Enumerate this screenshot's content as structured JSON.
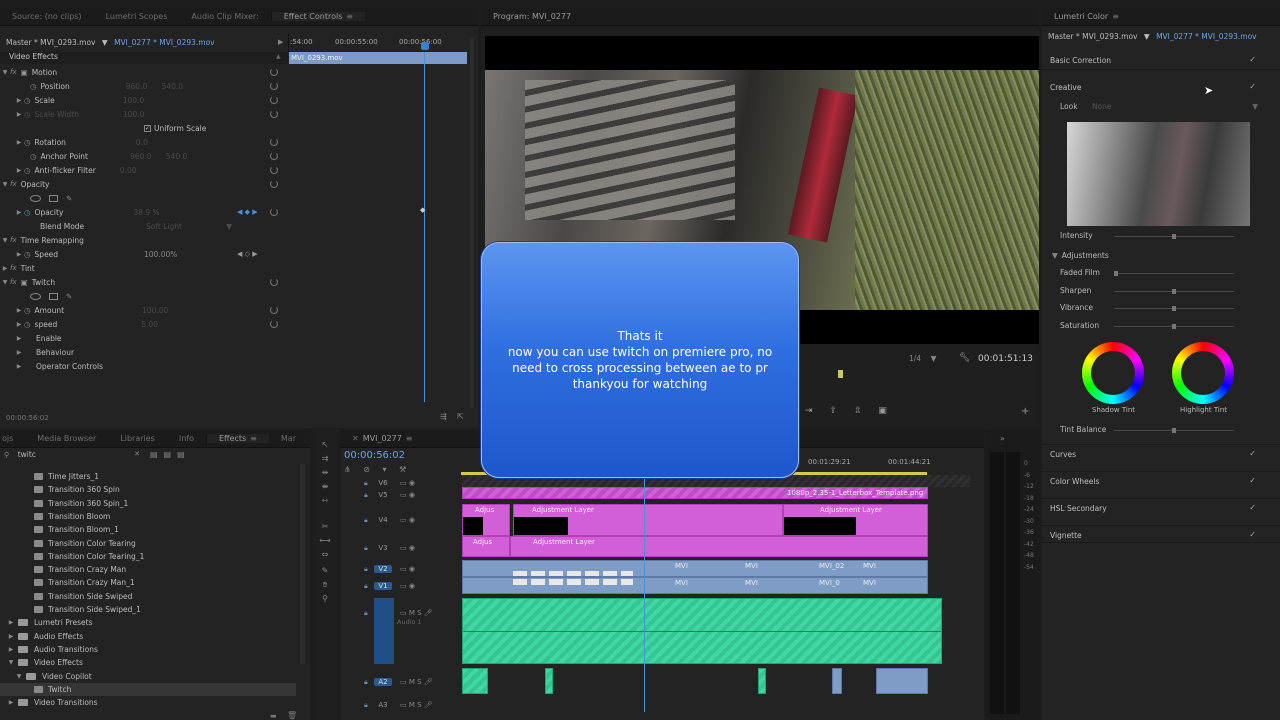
{
  "effect_controls": {
    "tabs": [
      "Source: (no clips)",
      "Lumetri Scopes",
      "Audio Clip Mixer:",
      "Effect Controls"
    ],
    "master_label": "Master * MVI_0293.mov",
    "clip_label": "MVI_0277 * MVI_0293.mov",
    "section_title": "Video Effects",
    "ruler": [
      ":54:00",
      "00:00:55:00",
      "00:00:56:00"
    ],
    "clip_bar": "MVI_0293.mov",
    "rows": {
      "motion": "Motion",
      "position": "Position",
      "scale": "Scale",
      "scale_width": "Scale Width",
      "uniform_scale": "Uniform Scale",
      "rotation": "Rotation",
      "anchor_point": "Anchor Point",
      "anti_flicker": "Anti-flicker Filter",
      "opacity_group": "Opacity",
      "opacity": "Opacity",
      "opacity_value": "38.9 %",
      "blend_mode": "Blend Mode",
      "blend_value": "Soft Light",
      "time_remap": "Time Remapping",
      "speed": "Speed",
      "speed_value": "100.00%",
      "tint": "Tint",
      "twitch": "Twitch",
      "amount": "Amount",
      "speed2": "speed",
      "enable": "Enable",
      "behaviour": "Behaviour",
      "operator_controls": "Operator Controls"
    },
    "timecode": "00:00:56:02"
  },
  "program_monitor": {
    "tab": "Program: MVI_0277",
    "zoom": "1/4",
    "timecode": "00:01:51:13"
  },
  "dialog": {
    "line1": "Thats it",
    "line2": "now you can use twitch on premiere pro, no need to cross processing between ae to pr",
    "line3": "thankyou for watching"
  },
  "effects_panel": {
    "tabs": [
      "ojs",
      "Media Browser",
      "Libraries",
      "Info",
      "Effects",
      "Mar"
    ],
    "search_value": "twitc",
    "items": [
      {
        "label": "Time Jitters_1",
        "indent": 2
      },
      {
        "label": "Transition 360 Spin",
        "indent": 2
      },
      {
        "label": "Transition 360 Spin_1",
        "indent": 2
      },
      {
        "label": "Transition Bloom",
        "indent": 2
      },
      {
        "label": "Transition Bloom_1",
        "indent": 2
      },
      {
        "label": "Transition Color Tearing",
        "indent": 2
      },
      {
        "label": "Transition Color Tearing_1",
        "indent": 2
      },
      {
        "label": "Transition Crazy Man",
        "indent": 2
      },
      {
        "label": "Transition Crazy Man_1",
        "indent": 2
      },
      {
        "label": "Transition Side Swiped",
        "indent": 2
      },
      {
        "label": "Transition Side Swiped_1",
        "indent": 2
      },
      {
        "label": "Lumetri Presets",
        "indent": 0
      },
      {
        "label": "Audio Effects",
        "indent": 0
      },
      {
        "label": "Audio Transitions",
        "indent": 0
      },
      {
        "label": "Video Effects",
        "indent": 0
      },
      {
        "label": "Video Copilot",
        "indent": 1
      },
      {
        "label": "Twitch",
        "indent": 2
      },
      {
        "label": "Video Transitions",
        "indent": 0
      }
    ]
  },
  "timeline": {
    "tab": "MVI_0277",
    "timecode": "00:00:56:02",
    "ruler": [
      "00:01:29:21",
      "00:01:44:21"
    ],
    "tracks": [
      "V6",
      "V5",
      "V4",
      "V3",
      "V2",
      "V1",
      "A1",
      "A2",
      "A3"
    ],
    "audio_label": "Audio 1",
    "clips": {
      "letterbox": "1080p_2.35-1_Letterbox_Template.png",
      "adjustment": "Adjustment Layer",
      "adjustment_short": "Adjus",
      "mvi": "MVI",
      "mvi_0": "MVI_0",
      "mvi_02": "MVI_02"
    }
  },
  "lumetri": {
    "tab": "Lumetri Color",
    "master_label": "Master * MVI_0293.mov",
    "clip_label": "MVI_0277 * MVI_0293.mov",
    "basic_correction": "Basic Correction",
    "creative": "Creative",
    "look_label": "Look",
    "look_value": "None",
    "intensity": "Intensity",
    "adjustments": "Adjustments",
    "faded_film": "Faded Film",
    "sharpen": "Sharpen",
    "vibrance": "Vibrance",
    "saturation": "Saturation",
    "shadow_tint": "Shadow Tint",
    "highlight_tint": "Highlight Tint",
    "tint_balance": "Tint Balance",
    "curves": "Curves",
    "color_wheels": "Color Wheels",
    "hsl_secondary": "HSL Secondary",
    "vignette": "Vignette",
    "check": "✓"
  }
}
